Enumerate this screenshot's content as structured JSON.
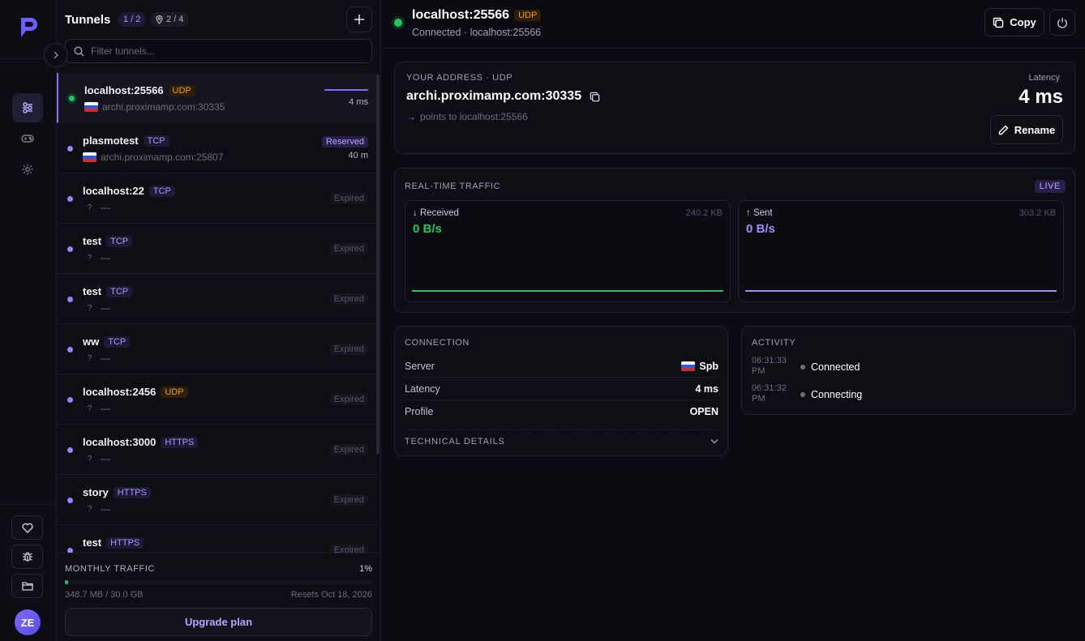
{
  "sidebar": {
    "user_initials": "ZE"
  },
  "tunnels": {
    "title": "Tunnels",
    "count_badge": "1 / 2",
    "pins_badge": "2 / 4",
    "filter_placeholder": "Filter tunnels...",
    "items": [
      {
        "name": "localhost:25566",
        "protocol": "UDP",
        "address": "archi.proximamp.com:30335",
        "status": "4 ms",
        "active": true
      },
      {
        "name": "plasmotest",
        "protocol": "TCP",
        "address": "archi.proximamp.com:25807",
        "badge": "Reserved",
        "status": "40 m"
      },
      {
        "name": "localhost:22",
        "protocol": "TCP",
        "q": "?",
        "address": "—",
        "badge": "Expired"
      },
      {
        "name": "test",
        "protocol": "TCP",
        "q": "?",
        "address": "—",
        "badge": "Expired"
      },
      {
        "name": "test",
        "protocol": "TCP",
        "q": "?",
        "address": "—",
        "badge": "Expired"
      },
      {
        "name": "ww",
        "protocol": "TCP",
        "q": "?",
        "address": "—",
        "badge": "Expired"
      },
      {
        "name": "localhost:2456",
        "protocol": "UDP",
        "q": "?",
        "address": "—",
        "badge": "Expired"
      },
      {
        "name": "localhost:3000",
        "protocol": "HTTPS",
        "q": "?",
        "address": "—",
        "badge": "Expired"
      },
      {
        "name": "story",
        "protocol": "HTTPS",
        "q": "?",
        "address": "—",
        "badge": "Expired"
      },
      {
        "name": "test",
        "protocol": "HTTPS",
        "q": "?",
        "address": "—",
        "badge": "Expired"
      }
    ]
  },
  "monthly_traffic": {
    "label": "MONTHLY TRAFFIC",
    "percent": "1%",
    "used": "348.7 MB / 30.0 GB",
    "reset": "Resets Oct 18, 2026",
    "upgrade_label": "Upgrade plan"
  },
  "header": {
    "title": "localhost:25566",
    "protocol": "UDP",
    "subtitle": "Connected · localhost:25566",
    "copy_label": "Copy"
  },
  "address_card": {
    "caption": "YOUR ADDRESS · UDP",
    "address": "archi.proximamp.com:30335",
    "points_to": "points to localhost:25566",
    "latency_label": "Latency",
    "latency_value": "4 ms",
    "rename_label": "Rename"
  },
  "realtime": {
    "caption": "REAL-TIME TRAFFIC",
    "live": "LIVE",
    "received": {
      "label": "Received",
      "total": "240.2 KB",
      "rate": "0 B/s"
    },
    "sent": {
      "label": "Sent",
      "total": "303.2 KB",
      "rate": "0 B/s"
    }
  },
  "connection": {
    "caption": "CONNECTION",
    "rows": [
      {
        "key": "Server",
        "value": "Spb"
      },
      {
        "key": "Latency",
        "value": "4 ms"
      },
      {
        "key": "Profile",
        "value": "OPEN"
      }
    ],
    "technical": "TECHNICAL DETAILS"
  },
  "activity": {
    "caption": "ACTIVITY",
    "events": [
      {
        "time": "06:31:33 PM",
        "event": "Connected"
      },
      {
        "time": "06:31:32 PM",
        "event": "Connecting"
      }
    ]
  },
  "colors": {
    "accent": "#8b6cff",
    "connected": "#22c55e",
    "udp": "#f59e0b"
  }
}
